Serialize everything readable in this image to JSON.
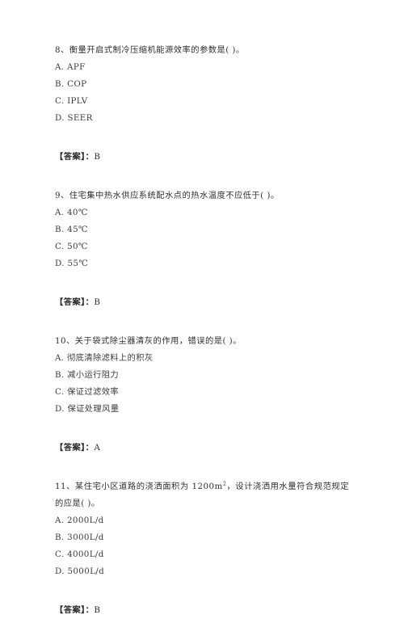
{
  "document": {
    "type": "exam-question-sheet",
    "language": "zh-CN",
    "background_color": "#ffffff",
    "text_color": "#2f2f33"
  },
  "questions": [
    {
      "number": "8",
      "stem": "8、衡量开启式制冷压缩机能源效率的参数是(  )。",
      "options": [
        "A. APF",
        "B. COP",
        "C. IPLV",
        "D. SEER"
      ],
      "answer_label": "【答案】：",
      "answer_value": "B"
    },
    {
      "number": "9",
      "stem": "9、住宅集中热水供应系统配水点的热水温度不应低于(  )。",
      "options": [
        "A. 40℃",
        "B. 45℃",
        "C. 50℃",
        "D. 55℃"
      ],
      "answer_label": "【答案】：",
      "answer_value": "B"
    },
    {
      "number": "10",
      "stem": "10、关于袋式除尘器清灰的作用，错误的是(  )。",
      "options": [
        "A. 彻底清除滤料上的积灰",
        "B. 减小运行阻力",
        "C. 保证过滤效率",
        "D. 保证处理风量"
      ],
      "answer_label": "【答案】：",
      "answer_value": "A"
    },
    {
      "number": "11",
      "stem_part1": "11、某住宅小区道路的浇洒面积为 1200m",
      "stem_superscript": "2",
      "stem_part2": "，设计浇洒用水量符合规范规定的应是(  )。",
      "options": [
        "A. 2000L/d",
        "B. 3000L/d",
        "C. 4000L/d",
        "D. 5000L/d"
      ],
      "answer_label": "【答案】：",
      "answer_value": "B"
    }
  ]
}
